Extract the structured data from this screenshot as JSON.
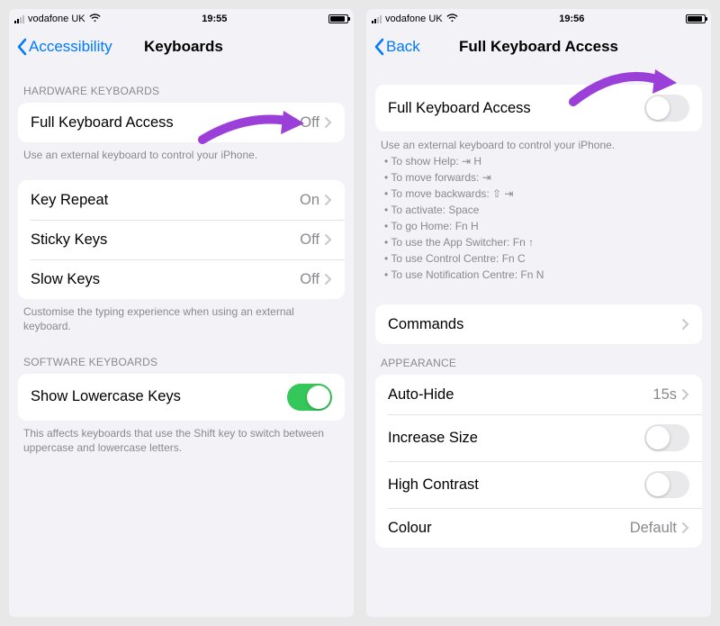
{
  "left": {
    "status": {
      "carrier": "vodafone UK",
      "time": "19:55"
    },
    "nav": {
      "back": "Accessibility",
      "title": "Keyboards"
    },
    "s1_header": "HARDWARE KEYBOARDS",
    "rows1": {
      "fka": {
        "label": "Full Keyboard Access",
        "value": "Off"
      }
    },
    "s1_footer": "Use an external keyboard to control your iPhone.",
    "rows2": {
      "keyrepeat": {
        "label": "Key Repeat",
        "value": "On"
      },
      "sticky": {
        "label": "Sticky Keys",
        "value": "Off"
      },
      "slow": {
        "label": "Slow Keys",
        "value": "Off"
      }
    },
    "s2_footer": "Customise the typing experience when using an external keyboard.",
    "s3_header": "SOFTWARE KEYBOARDS",
    "rows3": {
      "lowercase": {
        "label": "Show Lowercase Keys"
      }
    },
    "s3_footer": "This affects keyboards that use the Shift key to switch between uppercase and lowercase letters."
  },
  "right": {
    "status": {
      "carrier": "vodafone UK",
      "time": "19:56"
    },
    "nav": {
      "back": "Back",
      "title": "Full Keyboard Access"
    },
    "rows1": {
      "fka": {
        "label": "Full Keyboard Access"
      }
    },
    "help": {
      "title": "Use an external keyboard to control your iPhone.",
      "items": [
        "To show Help: ⇥ H",
        "To move forwards: ⇥",
        "To move backwards: ⇧ ⇥",
        "To activate: Space",
        "To go Home: Fn H",
        "To use the App Switcher: Fn ↑",
        "To use Control Centre: Fn C",
        "To use Notification Centre: Fn N"
      ]
    },
    "rows2": {
      "commands": {
        "label": "Commands"
      }
    },
    "s3_header": "APPEARANCE",
    "rows3": {
      "autohide": {
        "label": "Auto-Hide",
        "value": "15s"
      },
      "incsize": {
        "label": "Increase Size"
      },
      "contrast": {
        "label": "High Contrast"
      },
      "colour": {
        "label": "Colour",
        "value": "Default"
      }
    }
  }
}
